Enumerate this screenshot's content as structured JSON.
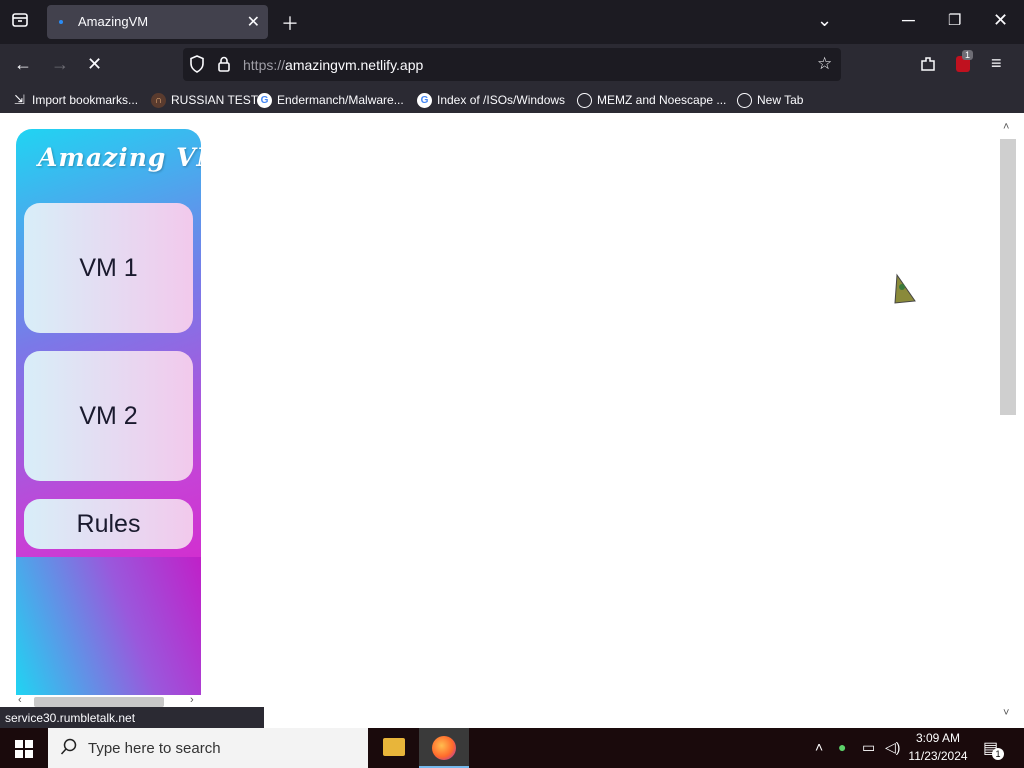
{
  "browser": {
    "tab_title": "AmazingVM",
    "url_protocol": "https://",
    "url_host": "amazingvm.netlify.app",
    "extension_badge": "1"
  },
  "bookmarks": [
    {
      "label": "Import bookmarks...",
      "icon": "import-icon"
    },
    {
      "label": "RUSSIAN TEST",
      "icon": "headphones-icon"
    },
    {
      "label": "Endermanch/Malware...",
      "icon": "google-icon"
    },
    {
      "label": "Index of /ISOs/Windows",
      "icon": "google-icon"
    },
    {
      "label": "MEMZ and Noescape ...",
      "icon": "globe-icon"
    },
    {
      "label": "New Tab",
      "icon": "globe-icon"
    }
  ],
  "page": {
    "logo_text": "Amazing VM",
    "buttons": [
      {
        "label": "VM 1"
      },
      {
        "label": "VM 2"
      },
      {
        "label": "Rules"
      }
    ]
  },
  "status_bar": {
    "text": "service30.rumbletalk.net"
  },
  "taskbar": {
    "search_placeholder": "Type here to search",
    "time": "3:09 AM",
    "date": "11/23/2024",
    "notification_count": "1"
  },
  "colors": {
    "accent": "#2a8cf5",
    "gradient_start": "#20d4f2",
    "gradient_end": "#e411c6"
  }
}
